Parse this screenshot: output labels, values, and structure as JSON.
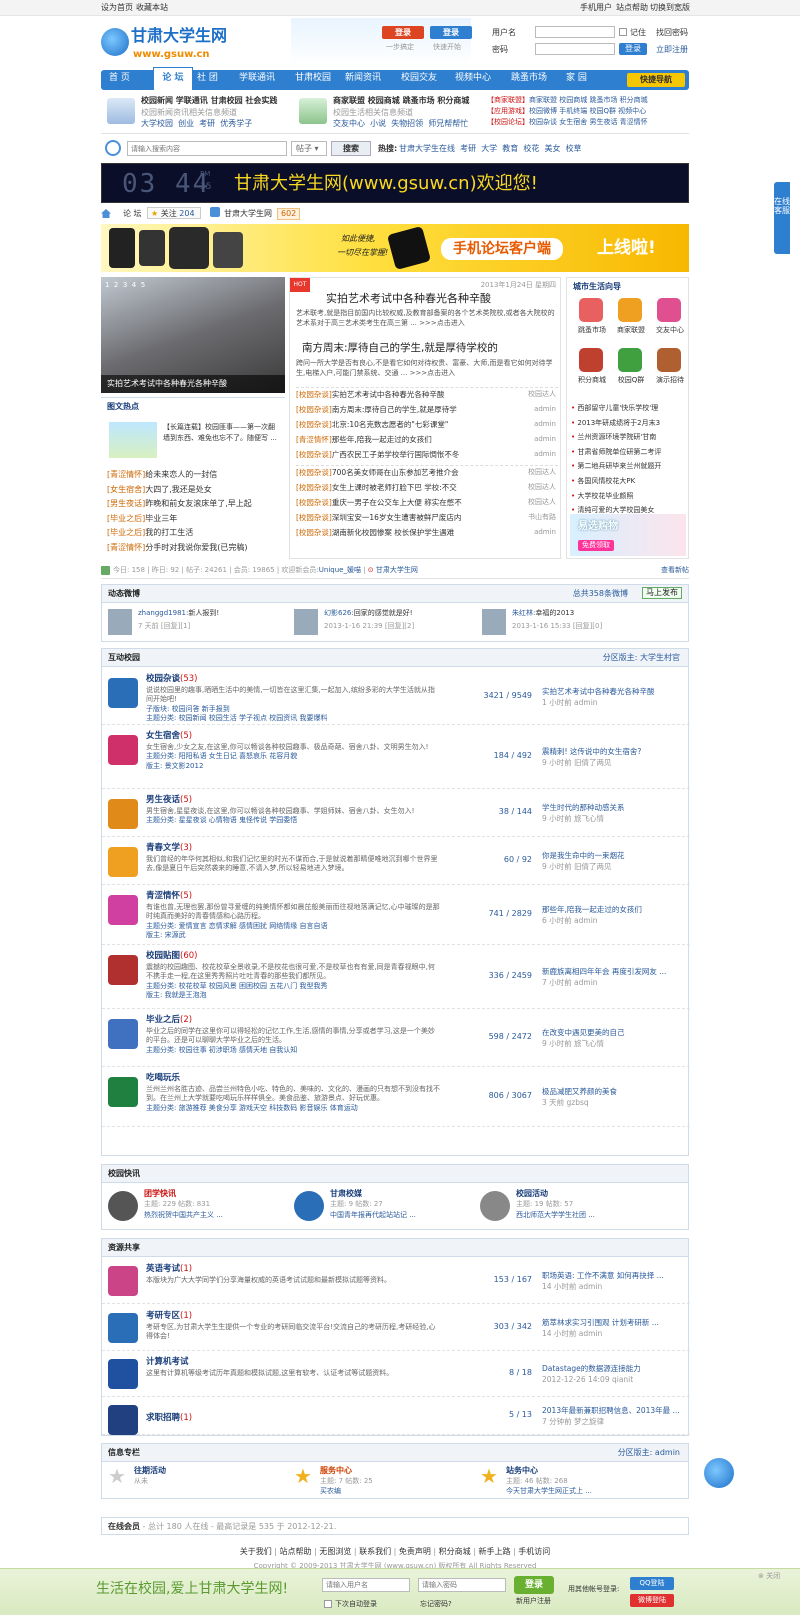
{
  "topbar": {
    "left": [
      "设为首页",
      "收藏本站"
    ],
    "right": [
      "手机用户",
      "站点帮助",
      "切换到宽版"
    ]
  },
  "header": {
    "logo_title": "甘肃大学生网",
    "logo_url": "www.gsuw.cn",
    "login_btn": "登录",
    "qq_login_btn": "登录",
    "one_step": "一步搞定",
    "quick_start": "快速开始",
    "username_label": "用户名",
    "password_label": "密码",
    "remember": "记住",
    "find_password": "找回密码",
    "login_submit": "登录",
    "register": "立即注册"
  },
  "nav": {
    "items": [
      "首 页",
      "论 坛",
      "社 团",
      "学联通讯",
      "甘肃校园",
      "新闻资讯",
      "校园交友",
      "视频中心",
      "跳蚤市场",
      "家 园"
    ],
    "active_index": 1,
    "quick_nav": "快捷导航"
  },
  "promo": {
    "col1": {
      "line1": "校园新闻 学联通讯 甘肃校园 社会实践",
      "line2": "校园新闻资讯相关信息频道",
      "line3": [
        "大学校园",
        "创业",
        "考研",
        "优秀学子"
      ]
    },
    "col2": {
      "line1": "商家联盟 校园商城 跳蚤市场 积分商城",
      "line2": "校园生活相关信息频道",
      "line3": [
        "交友中心",
        "小说",
        "失物招领",
        "师兄帮帮忙"
      ]
    },
    "col3": [
      {
        "tag": "【商家联盟】",
        "items": "商家联盟 校园商城 跳蚤市场 积分商城"
      },
      {
        "tag": "【应用游戏】",
        "items": "校园微博 手机终端 校园Q群 视频中心"
      },
      {
        "tag": "【校园论坛】",
        "items": "校园杂谈 女生宿舍 男生夜话 青涩情怀"
      }
    ]
  },
  "search": {
    "placeholder": "请输入搜索内容",
    "type": "帖子",
    "button": "搜索",
    "hot_label": "热搜:",
    "hot": [
      "甘肃大学生在线",
      "考研",
      "大学",
      "教育",
      "校花",
      "美女",
      "校草"
    ]
  },
  "banner": {
    "clock": "03 44",
    "clock_pm": "PM",
    "clock_sec": "35",
    "welcome": "甘肃大学生网(www.gsuw.cn)欢迎您!"
  },
  "breadcrumb": {
    "home": "论 坛",
    "follow": "关注",
    "follow_count": "204",
    "site": "甘肃大学生网",
    "site_count": "602"
  },
  "ad_banner": {
    "slogan1": "如此便捷,",
    "slogan2": "一切尽在掌握!",
    "title": "手机论坛客户端",
    "title2": "上线啦!"
  },
  "slider": {
    "caption": "实拍艺术考试中各种春光各种辛酸",
    "pages": [
      "1",
      "2",
      "3",
      "4",
      "5"
    ]
  },
  "headline": {
    "date": "2013年1月24日 星期四",
    "title1": "实拍艺术考试中各种春光各种辛酸",
    "desc1": "艺术联考,就是指目前国内比较权威,及教育部备案的各个艺术类院校,或者各大院校的艺术系对于高三艺术类考生在高三第 ... >>>点击进入",
    "title2": "南方周末:厚待自己的学生,就是厚待学校的",
    "desc2": "跨问一所大学是否有良心,不是看它如何对待权贵、富豪、大师,而是看它如何对待学生,电梯入户,可能门禁系统、交通 ... >>>点击进入",
    "list": [
      {
        "tag": "[校园杂谈]",
        "t": "实拍艺术考试中各种春光各种辛酸",
        "u": "校园达人"
      },
      {
        "tag": "[校园杂谈]",
        "t": "南方周末:厚待自己的学生,就是厚待学",
        "u": "admin"
      },
      {
        "tag": "[校园杂谈]",
        "t": "北京:10名克数志愿者的\"七彩课堂\"",
        "u": "admin"
      },
      {
        "tag": "[青涩情怀]",
        "t": "那些年,陪我一起走过的女孩们",
        "u": "admin"
      },
      {
        "tag": "[校园杂谈]",
        "t": "广西农民工子弟学校举行国际惆怅不冬",
        "u": "admin"
      },
      {
        "tag": "[校园杂谈]",
        "t": "700名美女师哥在山东参加艺考推介会",
        "u": "校园达人"
      },
      {
        "tag": "[校园杂谈]",
        "t": "女生上课时被老师打脸下巴 学校:不交",
        "u": "校园达人"
      },
      {
        "tag": "[校园杂谈]",
        "t": "重庆一男子在公交车上大便 称实在憋不",
        "u": "校园达人"
      },
      {
        "tag": "[校园杂谈]",
        "t": "深圳宝安一16岁女生遭害被鲜尸废店内",
        "u": "书山有路"
      },
      {
        "tag": "[校园杂谈]",
        "t": "湖南新化校园惨案 校长保护学生遇难",
        "u": "admin"
      }
    ]
  },
  "picnews": {
    "title": "图文热点",
    "feature_title": "【长篇连载】校园匪事——第一次翻墙到东西、难免也忘不了。随便写 ...",
    "list": [
      {
        "tag": "[青涩情怀]",
        "t": "给未来恋人的一封信"
      },
      {
        "tag": "[女生宿舍]",
        "t": "大四了,我还是处女"
      },
      {
        "tag": "[男生夜话]",
        "t": "昨晚和前女友滚床单了,早上起"
      },
      {
        "tag": "[毕业之后]",
        "t": "毕业三年"
      },
      {
        "tag": "[毕业之后]",
        "t": "我的打工生活"
      },
      {
        "tag": "[青涩情怀]",
        "t": "分手时对我说你爱我(已完稿)"
      }
    ]
  },
  "city": {
    "title": "城市生活向导",
    "icons": [
      "跳蚤市场",
      "商家联盟",
      "交友中心",
      "积分商城",
      "校园Q群",
      "演示招待"
    ],
    "list": [
      "西部留守儿童'快乐学校'理",
      "2013年研成绩将于2月末3",
      "兰州资源环境学院研'甘南",
      "甘肃省师院单位研第二考评",
      "第二地兵研毕来兰州就题开",
      "各国风情校花大PK",
      "大学校花毕业颜照",
      "清纯可爱的大学校园美女"
    ],
    "ad": "易选购物",
    "ad2": "免费领取"
  },
  "stats": {
    "today": "今日: 158",
    "yesterday": "昨日: 92",
    "posts": "帖子: 24261",
    "members": "会员: 19865",
    "welcome": "欢迎新会员:",
    "newuser": "Unique_媛喵",
    "site": "甘肃大学生网",
    "latest": "查看新帖"
  },
  "weibo": {
    "title": "动态微博",
    "total": "总共358条微博",
    "post": "马上发布",
    "items": [
      {
        "user": "zhanggd1981:",
        "text": "新人报到!",
        "meta": "7 天前 [回复][1]"
      },
      {
        "user": "幻影626:",
        "text": "回家的感觉就是好!",
        "meta": "2013-1-16 21:39 [回复][2]"
      },
      {
        "user": "朱红林:",
        "text": "幸福的2013",
        "meta": "2013-1-16 15:33 [回复][0]"
      }
    ]
  },
  "interactive": {
    "title": "互动校园",
    "moderator": "分区版主: 大学生村官",
    "forums": [
      {
        "name": "校园杂谈",
        "new": "(53)",
        "desc": "说说校园里的趣事,晒晒生活中的美情,一切皆在这里汇集,一起加入,缤纷多彩的大学生活就从指间开始吧!",
        "sub": "子版块: 校园问答 新手报到",
        "sub2": "主题分类: 校园新闻 校园生活 学子视点 校园资讯 我要爆料",
        "stats": "3421 / 9549",
        "last": "实拍艺术考试中各种春光各种辛酸",
        "lastmeta": "1 小时前 admin",
        "color": "#2a6eb8"
      },
      {
        "name": "女生宿舍",
        "new": "(5)",
        "desc": "女生宿舍,少女之友,在这里,你可以畅谈各种校园趣事、极品奇葩、宿舍八卦、文明男生勿入!",
        "sub": "主题分类: 阳阳私语 女生日记 喜怒哀乐 花容月貌",
        "sub2": "版主: 景文影2012",
        "stats": "184 / 492",
        "last": "震精刺! 这传说中的女生宿舍?",
        "lastmeta": "9 小时前 旧倩了两见",
        "color": "#d0306a"
      },
      {
        "name": "男生夜话",
        "new": "(5)",
        "desc": "男生宿舍,星星夜谈,在这里,你可以畅谈各种校园趣事、学姐师妹、宿舍八卦、女生勿入!",
        "sub": "主题分类: 星星夜谈 心情物语 鬼怪传说 学园委悟",
        "sub2": "",
        "stats": "38 / 144",
        "last": "学生时代的那种动感关系",
        "lastmeta": "9 小时前 旅飞心情",
        "color": "#e08a1a"
      },
      {
        "name": "青春文学",
        "new": "(3)",
        "desc": "我们曾经的年华何其相似,和我们记忆里的时光不谋而合,于是就说着那睛便唯地沉到哪个世界里去,像是夏日午后突然袭来的睡意,不请入梦,所以轻易地进入梦境。",
        "sub": "",
        "sub2": "",
        "stats": "60 / 92",
        "last": "你是我生命中的一束烟花",
        "lastmeta": "9 小时前 旧倩了两见",
        "color": "#f0a020"
      },
      {
        "name": "青涩情怀",
        "new": "(5)",
        "desc": "有谁也曾,无理也罢,那份曾寻爱缠的纯美情怀都如晨芘般美丽而往视地落满记忆,心中璀璨的是那时纯真而美好的青春情感和心路历程。",
        "sub": "主题分类: 爱情宣言 恋情求解 感情困扰 网络情缘 自言自语",
        "sub2": "版主: 宋源武",
        "stats": "741 / 2829",
        "last": "那些年,陪我一起走过的女孩们",
        "lastmeta": "6 小时前 admin",
        "color": "#d040a0"
      },
      {
        "name": "校园贴图",
        "new": "(60)",
        "desc": "震撼的校园趣图、校花校草全景收录,不是校花也很可爱,不是校草也有有爱,同是青春视眼中,何不携手走一程,在这里秀秀照片吐吐青春的那些我们都所见。",
        "sub": "主题分类: 校花校草 校园风景 困困校园 五花八门 我型我秀",
        "sub2": "版主: 我就是王泡泡",
        "stats": "336 / 2459",
        "last": "新鹿族离相四年年会 再度引发网友 ...",
        "lastmeta": "7 小时前 admin",
        "color": "#b03030"
      },
      {
        "name": "毕业之后",
        "new": "(2)",
        "desc": "毕业之后的同学在这里你可以得轻松的记忆工作,生活,感情的事情,分享或者学习,这是一个美妙的平台。还是可以聊聊大学毕业之后的生活。",
        "sub": "主题分类: 校园往事 初涉职场 感情天地 自我认知",
        "sub2": "",
        "stats": "598 / 2472",
        "last": "在改变中遇见更美的自己",
        "lastmeta": "9 小时前 旅飞心情",
        "color": "#4070c0"
      },
      {
        "name": "吃喝玩乐",
        "new": "",
        "desc": "兰州兰州名胜古迹、品尝兰州特色小吃、特色的、美味的、文化的、漫画的只有想不到没有找不到。在兰州上大学就要吃喝玩乐样样俱全。美食品鉴、旅游景点、好玩优惠。",
        "sub": "主题分类: 旅游推荐 美食分享 游戏天空 科技数码 影音娱乐 体育运动",
        "sub2": "",
        "stats": "806 / 3067",
        "last": "极品减肥又养颜的美食",
        "lastmeta": "3 天前 gzbsq",
        "color": "#208040"
      }
    ]
  },
  "express": {
    "title": "校园快讯",
    "items": [
      {
        "name": "团学快讯",
        "meta": "主题: 229 帖数: 831",
        "last": "热烈祝贺中国共产主义 ..."
      },
      {
        "name": "甘肃校媒",
        "meta": "主题: 9 帖数: 27",
        "last": "中国青年报再代起站站记 ..."
      },
      {
        "name": "校园活动",
        "meta": "主题: 19 帖数: 57",
        "last": "西北师范大学学生社团 ..."
      }
    ]
  },
  "resources": {
    "title": "资源共享",
    "forums": [
      {
        "name": "英语考试",
        "new": "(1)",
        "desc": "本版块为广大大学同学们分享海量权威的英语考试试题和最新模拟试题等资料。",
        "stats": "153 / 167",
        "last": "职场英语: 工作不满意 如何再抉择 ...",
        "lastmeta": "14 小时前 admin",
        "color": "#cc4488"
      },
      {
        "name": "考研专区",
        "new": "(1)",
        "desc": "考研专区,为甘肃大学生生提供一个专业的考研同临交流平台!交流自己的考研历程,考研经验,心得体会!",
        "stats": "303 / 342",
        "last": "筋萃林求实习引围观 计划考研新 ...",
        "lastmeta": "14 小时前 admin",
        "color": "#2a6eb8"
      },
      {
        "name": "计算机考试",
        "new": "",
        "desc": "这里有计算机等级考试历年真题和模拟试题,这里有软考、认证考试等试题资料。",
        "stats": "8 / 18",
        "last": "Datastage的数据源连接能力",
        "lastmeta": "2012-12-26 14:09 qianit",
        "color": "#2050a0"
      },
      {
        "name": "求职招聘",
        "new": "(1)",
        "desc": "",
        "stats": "5 / 13",
        "last": "2013年最新兼职招聘信息、2013年最 ...",
        "lastmeta": "7 分钟前 梦之旋律",
        "color": "#204080"
      }
    ]
  },
  "info": {
    "title": "信息专栏",
    "moderator": "分区版主: admin",
    "items": [
      {
        "name": "往期活动",
        "meta": "从未",
        "last": ""
      },
      {
        "name": "服务中心",
        "meta": "主题: 7 帖数: 25",
        "last": "买农编"
      },
      {
        "name": "站务中心",
        "meta": "主题: 46 帖数: 268",
        "last": "今天甘肃大学生网正式上 ..."
      }
    ]
  },
  "online": {
    "label": "在线会员",
    "text": "- 总计 180 人在线 - 最高记录是 535 于 2012-12-21."
  },
  "footer": {
    "links": [
      "关于我们",
      "站点帮助",
      "无图浏览",
      "联系我们",
      "免责声明",
      "积分商城",
      "新手上路",
      "手机访问"
    ],
    "copyright": "Copyright © 2009-2013 甘肃大学生网 (www.gsuw.cn) 版权所有 All Rights Reserved"
  },
  "bottombar": {
    "slogan": "生活在校园,爱上甘肃大学生网!",
    "user_ph": "请输入用户名",
    "pass_ph": "请输入密码",
    "login": "登录",
    "auto_login": "下次自动登录",
    "forgot": "忘记密码?",
    "register": "新用户注册",
    "other_login": "用其他帐号登录:",
    "qq": "QQ登陆",
    "weibo": "微博登陆",
    "close": "关闭"
  },
  "side_service": "在线客服",
  "colors": {
    "nav": "#2e7fcf",
    "link": "#2a5a9b",
    "red": "#cc1111",
    "banner_bg": "#0a0e28",
    "banner_text": "#f8d820"
  }
}
